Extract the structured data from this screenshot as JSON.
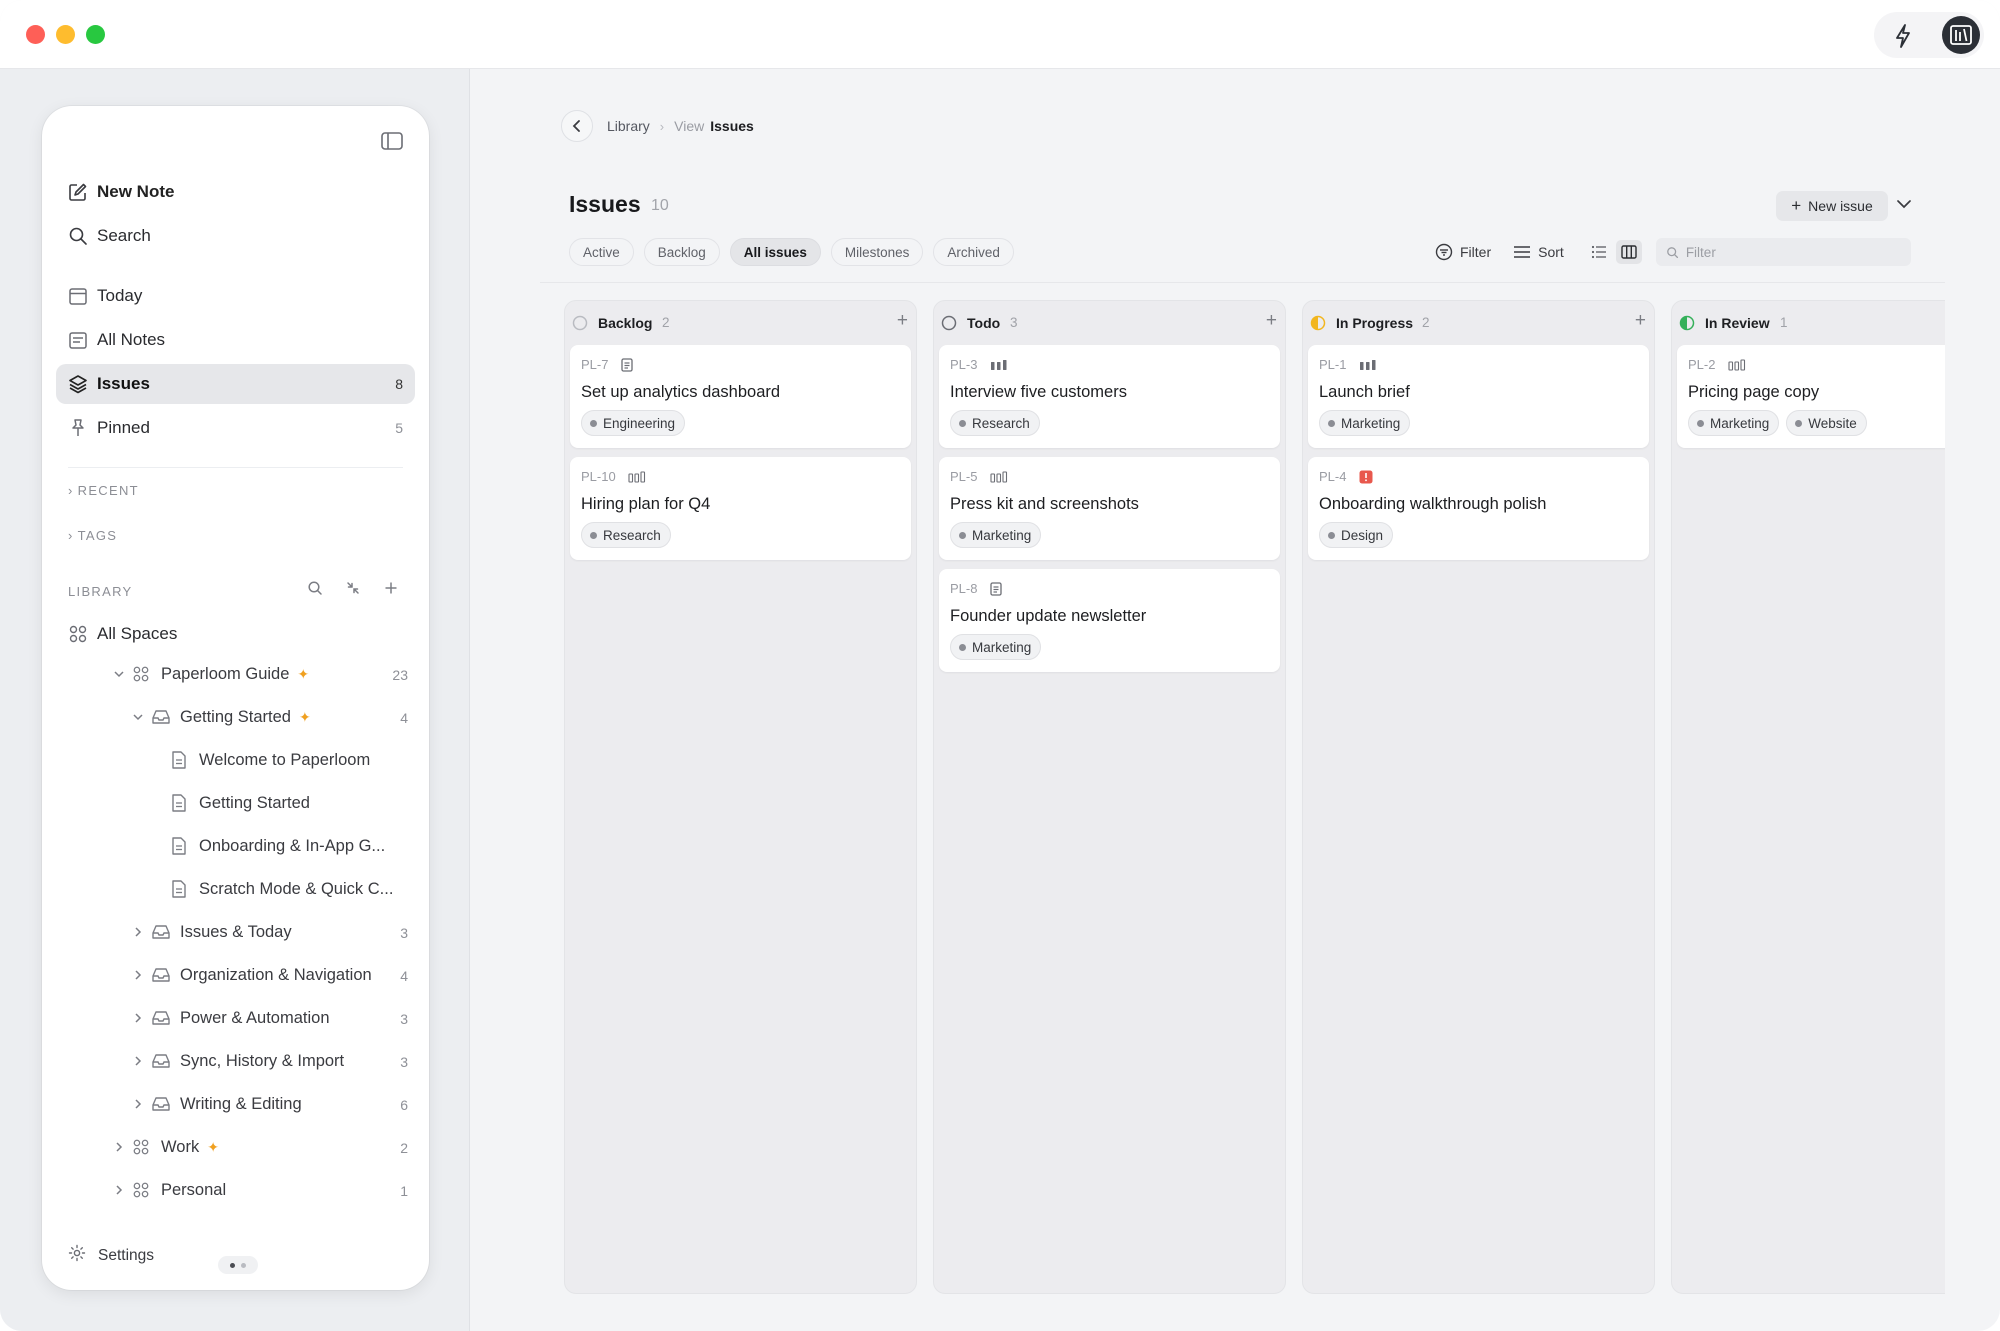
{
  "window": {
    "accent": "#2b2f36",
    "traffic_lights": [
      "#fe5f57",
      "#febc2e",
      "#28c840"
    ]
  },
  "sidebar": {
    "nav": [
      {
        "label": "New Note",
        "icon": "compose-icon"
      },
      {
        "label": "Search",
        "icon": "search-icon"
      },
      {
        "label": "Today",
        "icon": "calendar-icon"
      },
      {
        "label": "All Notes",
        "icon": "notes-icon"
      },
      {
        "label": "Issues",
        "icon": "layers-icon",
        "count": "8",
        "active": true
      },
      {
        "label": "Pinned",
        "icon": "pin-icon",
        "count": "5"
      }
    ],
    "sections": {
      "recent": "RECENT",
      "tags": "TAGS",
      "library": "LIBRARY"
    },
    "library": {
      "all_spaces": "All Spaces",
      "tree": [
        {
          "label": "Paperloom Guide",
          "count": "23",
          "pinned": true
        },
        {
          "label": "Getting Started",
          "count": "4",
          "pinned": true
        },
        {
          "label": "Welcome to Paperloom"
        },
        {
          "label": "Getting Started"
        },
        {
          "label": "Onboarding & In-App G..."
        },
        {
          "label": "Scratch Mode & Quick C..."
        },
        {
          "label": "Issues & Today",
          "count": "3"
        },
        {
          "label": "Organization & Navigation",
          "count": "4"
        },
        {
          "label": "Power & Automation",
          "count": "3"
        },
        {
          "label": "Sync, History & Import",
          "count": "3"
        },
        {
          "label": "Writing & Editing",
          "count": "6"
        },
        {
          "label": "Work",
          "count": "2",
          "pinned": true
        },
        {
          "label": "Personal",
          "count": "1"
        }
      ]
    },
    "settings_label": "Settings"
  },
  "main": {
    "breadcrumb": {
      "library": "Library",
      "view": "View",
      "current": "Issues"
    },
    "title": "Issues",
    "count": "10",
    "new_issue": "New issue",
    "tabs": [
      {
        "label": "Active"
      },
      {
        "label": "Backlog"
      },
      {
        "label": "All issues",
        "active": true
      },
      {
        "label": "Milestones"
      },
      {
        "label": "Archived"
      }
    ],
    "filter_label": "Filter",
    "sort_label": "Sort",
    "filter_placeholder": "Filter"
  },
  "board": {
    "columns": [
      {
        "name": "Backlog",
        "count": "2",
        "status_color": "#b9bbc1",
        "cards": [
          {
            "id": "PL-7",
            "priority": "doc",
            "title": "Set up analytics dashboard",
            "tags": [
              "Engineering"
            ]
          },
          {
            "id": "PL-10",
            "priority": "low",
            "title": "Hiring plan for Q4",
            "tags": [
              "Research"
            ]
          }
        ]
      },
      {
        "name": "Todo",
        "count": "3",
        "status_color": "#6b6d74",
        "cards": [
          {
            "id": "PL-3",
            "priority": "high",
            "title": "Interview five customers",
            "tags": [
              "Research"
            ]
          },
          {
            "id": "PL-5",
            "priority": "low",
            "title": "Press kit and screenshots",
            "tags": [
              "Marketing"
            ]
          },
          {
            "id": "PL-8",
            "priority": "doc",
            "title": "Founder update newsletter",
            "tags": [
              "Marketing"
            ]
          }
        ]
      },
      {
        "name": "In Progress",
        "count": "2",
        "status_color": "#f2b61f",
        "cards": [
          {
            "id": "PL-1",
            "priority": "high",
            "title": "Launch brief",
            "tags": [
              "Marketing"
            ]
          },
          {
            "id": "PL-4",
            "priority": "urgent",
            "title": "Onboarding walkthrough polish",
            "tags": [
              "Design"
            ]
          }
        ]
      },
      {
        "name": "In Review",
        "count": "1",
        "status_color": "#35b05a",
        "cards": [
          {
            "id": "PL-2",
            "priority": "low",
            "title": "Pricing page copy",
            "tags": [
              "Marketing",
              "Website"
            ]
          }
        ]
      }
    ]
  }
}
